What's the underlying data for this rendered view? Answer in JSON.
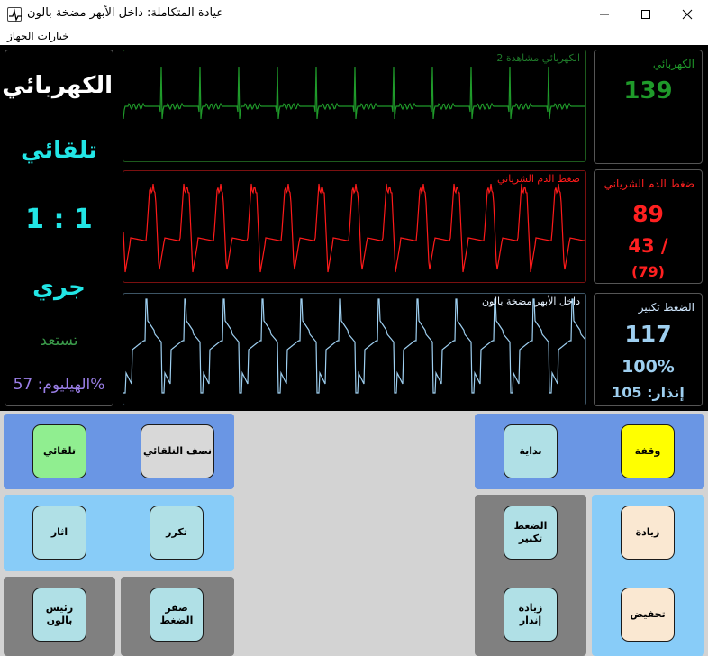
{
  "window": {
    "title": "عيادة المتكاملة: داخل الأبهر مضخة بالون",
    "icon": "heart-monitor-icon",
    "minimize_icon": "minimize-icon",
    "maximize_icon": "maximize-icon",
    "close_icon": "close-icon"
  },
  "menu": {
    "device_options": "خيارات الجهاز"
  },
  "status_panel": {
    "trigger_source": "الكهربائي",
    "mode": "تلقائي",
    "ratio": "1 : 1",
    "state": "جري",
    "ready": "تستعد",
    "helium": "%الهيليوم: 57"
  },
  "waveforms": {
    "ecg_label": "الكهربائي مشاهدة 2",
    "arterial_label": "ضغط الدم الشرياني",
    "balloon_label": "داخل الأبهر مضخة بالون",
    "colors": {
      "ecg": "#1f9a2a",
      "arterial": "#ff1a1a",
      "balloon": "#9ecff0"
    }
  },
  "numerics": {
    "ecg": {
      "label": "الكهربائي",
      "value": "139",
      "color": "#1f9a2a"
    },
    "arterial": {
      "label": "ضغط الدم الشرياني",
      "systolic": "89",
      "diastolic": "/ 43",
      "mean": "(79)",
      "color": "#ff2020"
    },
    "augmentation": {
      "label": "الضغط تكبير",
      "value": "117",
      "percent": "100%",
      "alarm": "إنذار: 105",
      "color": "#9ecff0"
    }
  },
  "buttons": {
    "auto": "تلقائي",
    "semi_auto": "نصف التلقائي",
    "start": "بداية",
    "stop": "وقفة",
    "trigger": "اثار",
    "frequency": "تكرر",
    "augment_pressure": "الضغط\nتكبير",
    "increase": "زيادة",
    "balloon_main": "رئيس\nبالون",
    "zero_pressure": "صفر\nالضغط",
    "increase_alarm": "زيادة\nإنذار",
    "decrease": "تخفيض"
  }
}
